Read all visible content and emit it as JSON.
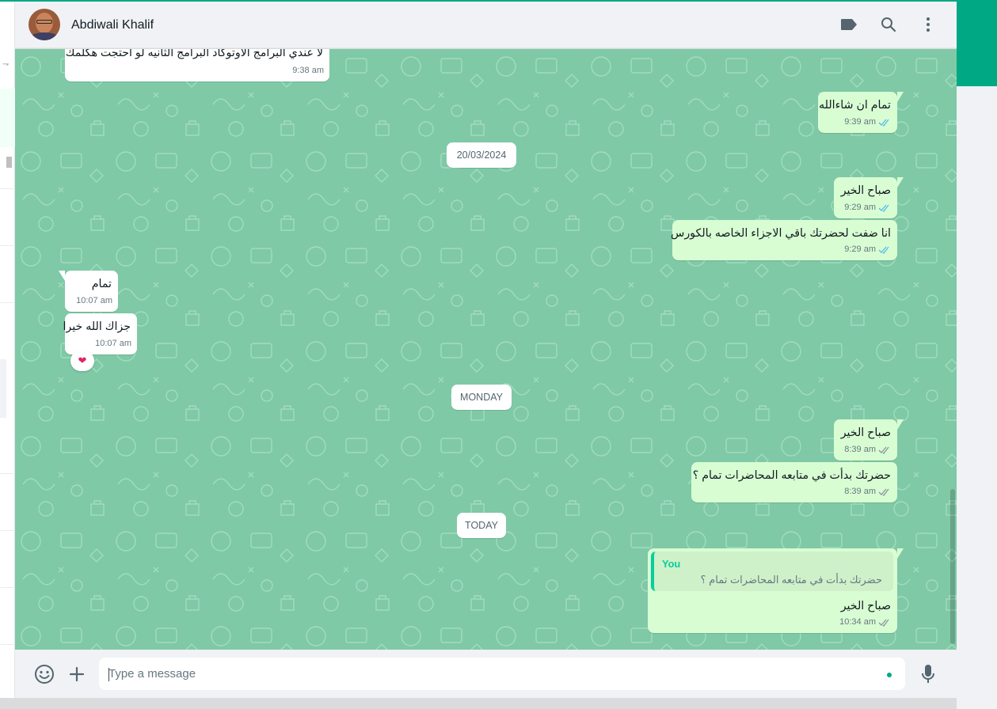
{
  "header": {
    "contact_name": "Abdiwali Khalif"
  },
  "icons": {
    "label": "label-icon",
    "search": "search-icon",
    "menu": "menu-icon",
    "emoji": "emoji-icon",
    "attach": "plus-icon",
    "mic": "mic-icon"
  },
  "colors": {
    "accent": "#00a884",
    "chat_background": "#7fc9a6",
    "incoming_bubble": "#ffffff",
    "outgoing_bubble": "#d9fdd3",
    "read_tick": "#53bdeb",
    "delivered_tick": "#8696a0"
  },
  "messages": [
    {
      "dir": "in",
      "text": "لا عندي البرامج الاوتوكاد البرامج الثانيه لو احتجت هكلمك",
      "time": "9:38 am"
    },
    {
      "dir": "out",
      "text": "تمام ان شاءالله",
      "time": "9:39 am",
      "status": "read"
    },
    {
      "dir": "out",
      "text": "صباح الخير",
      "time": "9:29 am",
      "status": "read"
    },
    {
      "dir": "out",
      "text": "انا ضفت لحضرتك باقي الاجزاء الخاصه بالكورس",
      "time": "9:29 am",
      "status": "read"
    },
    {
      "dir": "in",
      "text": "تمام",
      "time": "10:07 am"
    },
    {
      "dir": "in",
      "text": "جزاك الله خيرا",
      "time": "10:07 am",
      "reaction": "❤"
    },
    {
      "dir": "out",
      "text": "صباح الخير",
      "time": "8:39 am",
      "status": "delivered"
    },
    {
      "dir": "out",
      "text": "حضرتك بدأت في متابعه المحاضرات تمام ؟",
      "time": "8:39 am",
      "status": "delivered"
    },
    {
      "dir": "out",
      "text": "صباح الخير",
      "time": "10:34 am",
      "status": "delivered",
      "quote": {
        "author": "You",
        "text": "حضرتك بدأت في متابعه المحاضرات تمام ؟"
      }
    }
  ],
  "date_separators": [
    "20/03/2024",
    "MONDAY",
    "TODAY"
  ],
  "composer": {
    "placeholder": "Type a message",
    "value": ""
  }
}
